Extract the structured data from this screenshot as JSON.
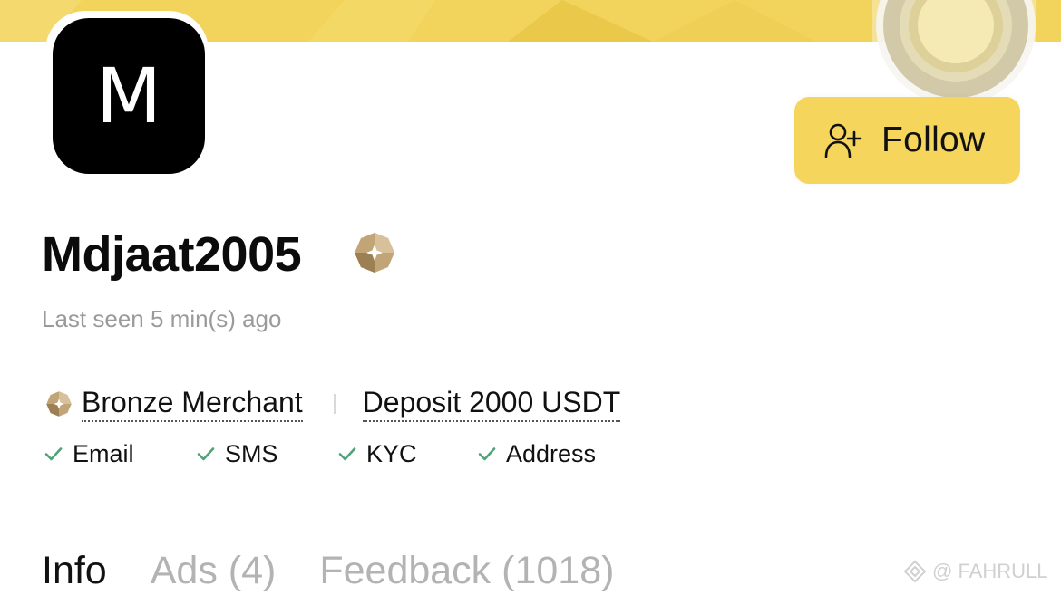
{
  "profile": {
    "avatar_letter": "M",
    "username": "Mdjaat2005",
    "last_seen": "Last seen 5 min(s) ago",
    "merchant_level": "Bronze Merchant",
    "deposit": "Deposit 2000 USDT"
  },
  "follow_button": {
    "label": "Follow",
    "icon": "user-plus-icon"
  },
  "verifications": [
    {
      "label": "Email",
      "icon": "check-icon"
    },
    {
      "label": "SMS",
      "icon": "check-icon"
    },
    {
      "label": "KYC",
      "icon": "check-icon"
    },
    {
      "label": "Address",
      "icon": "check-icon"
    }
  ],
  "tabs": [
    {
      "label": "Info",
      "active": true
    },
    {
      "label": "Ads (4)",
      "active": false
    },
    {
      "label": "Feedback (1018)",
      "active": false
    }
  ],
  "watermark": "@ FAHRULL",
  "colors": {
    "brand_yellow": "#f6d55c",
    "check_green": "#4fa37a",
    "badge_bronze": "#b89a6a",
    "muted_text": "#9a9a9a"
  }
}
